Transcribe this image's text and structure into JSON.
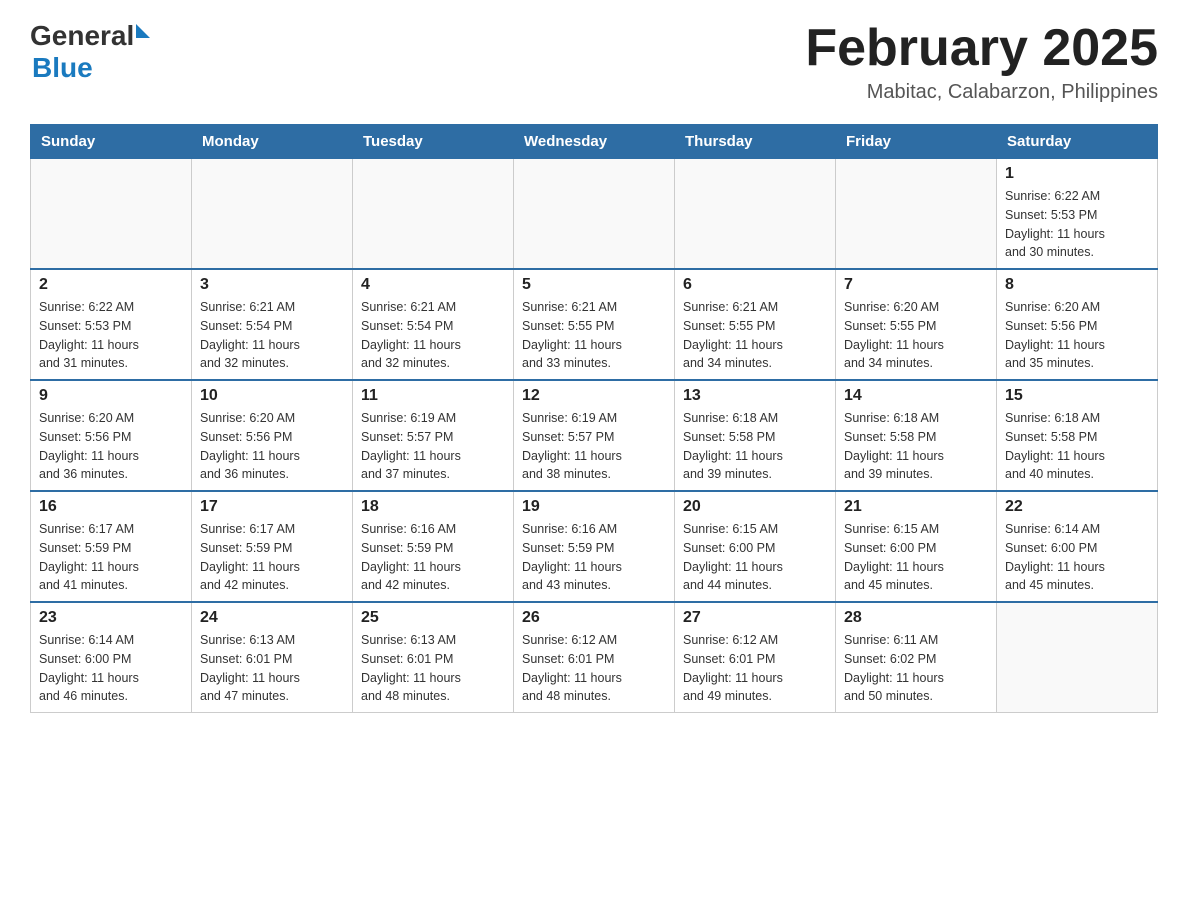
{
  "header": {
    "logo_general": "General",
    "logo_blue": "Blue",
    "title": "February 2025",
    "subtitle": "Mabitac, Calabarzon, Philippines"
  },
  "days_of_week": [
    "Sunday",
    "Monday",
    "Tuesday",
    "Wednesday",
    "Thursday",
    "Friday",
    "Saturday"
  ],
  "weeks": [
    [
      {
        "day": "",
        "info": ""
      },
      {
        "day": "",
        "info": ""
      },
      {
        "day": "",
        "info": ""
      },
      {
        "day": "",
        "info": ""
      },
      {
        "day": "",
        "info": ""
      },
      {
        "day": "",
        "info": ""
      },
      {
        "day": "1",
        "info": "Sunrise: 6:22 AM\nSunset: 5:53 PM\nDaylight: 11 hours\nand 30 minutes."
      }
    ],
    [
      {
        "day": "2",
        "info": "Sunrise: 6:22 AM\nSunset: 5:53 PM\nDaylight: 11 hours\nand 31 minutes."
      },
      {
        "day": "3",
        "info": "Sunrise: 6:21 AM\nSunset: 5:54 PM\nDaylight: 11 hours\nand 32 minutes."
      },
      {
        "day": "4",
        "info": "Sunrise: 6:21 AM\nSunset: 5:54 PM\nDaylight: 11 hours\nand 32 minutes."
      },
      {
        "day": "5",
        "info": "Sunrise: 6:21 AM\nSunset: 5:55 PM\nDaylight: 11 hours\nand 33 minutes."
      },
      {
        "day": "6",
        "info": "Sunrise: 6:21 AM\nSunset: 5:55 PM\nDaylight: 11 hours\nand 34 minutes."
      },
      {
        "day": "7",
        "info": "Sunrise: 6:20 AM\nSunset: 5:55 PM\nDaylight: 11 hours\nand 34 minutes."
      },
      {
        "day": "8",
        "info": "Sunrise: 6:20 AM\nSunset: 5:56 PM\nDaylight: 11 hours\nand 35 minutes."
      }
    ],
    [
      {
        "day": "9",
        "info": "Sunrise: 6:20 AM\nSunset: 5:56 PM\nDaylight: 11 hours\nand 36 minutes."
      },
      {
        "day": "10",
        "info": "Sunrise: 6:20 AM\nSunset: 5:56 PM\nDaylight: 11 hours\nand 36 minutes."
      },
      {
        "day": "11",
        "info": "Sunrise: 6:19 AM\nSunset: 5:57 PM\nDaylight: 11 hours\nand 37 minutes."
      },
      {
        "day": "12",
        "info": "Sunrise: 6:19 AM\nSunset: 5:57 PM\nDaylight: 11 hours\nand 38 minutes."
      },
      {
        "day": "13",
        "info": "Sunrise: 6:18 AM\nSunset: 5:58 PM\nDaylight: 11 hours\nand 39 minutes."
      },
      {
        "day": "14",
        "info": "Sunrise: 6:18 AM\nSunset: 5:58 PM\nDaylight: 11 hours\nand 39 minutes."
      },
      {
        "day": "15",
        "info": "Sunrise: 6:18 AM\nSunset: 5:58 PM\nDaylight: 11 hours\nand 40 minutes."
      }
    ],
    [
      {
        "day": "16",
        "info": "Sunrise: 6:17 AM\nSunset: 5:59 PM\nDaylight: 11 hours\nand 41 minutes."
      },
      {
        "day": "17",
        "info": "Sunrise: 6:17 AM\nSunset: 5:59 PM\nDaylight: 11 hours\nand 42 minutes."
      },
      {
        "day": "18",
        "info": "Sunrise: 6:16 AM\nSunset: 5:59 PM\nDaylight: 11 hours\nand 42 minutes."
      },
      {
        "day": "19",
        "info": "Sunrise: 6:16 AM\nSunset: 5:59 PM\nDaylight: 11 hours\nand 43 minutes."
      },
      {
        "day": "20",
        "info": "Sunrise: 6:15 AM\nSunset: 6:00 PM\nDaylight: 11 hours\nand 44 minutes."
      },
      {
        "day": "21",
        "info": "Sunrise: 6:15 AM\nSunset: 6:00 PM\nDaylight: 11 hours\nand 45 minutes."
      },
      {
        "day": "22",
        "info": "Sunrise: 6:14 AM\nSunset: 6:00 PM\nDaylight: 11 hours\nand 45 minutes."
      }
    ],
    [
      {
        "day": "23",
        "info": "Sunrise: 6:14 AM\nSunset: 6:00 PM\nDaylight: 11 hours\nand 46 minutes."
      },
      {
        "day": "24",
        "info": "Sunrise: 6:13 AM\nSunset: 6:01 PM\nDaylight: 11 hours\nand 47 minutes."
      },
      {
        "day": "25",
        "info": "Sunrise: 6:13 AM\nSunset: 6:01 PM\nDaylight: 11 hours\nand 48 minutes."
      },
      {
        "day": "26",
        "info": "Sunrise: 6:12 AM\nSunset: 6:01 PM\nDaylight: 11 hours\nand 48 minutes."
      },
      {
        "day": "27",
        "info": "Sunrise: 6:12 AM\nSunset: 6:01 PM\nDaylight: 11 hours\nand 49 minutes."
      },
      {
        "day": "28",
        "info": "Sunrise: 6:11 AM\nSunset: 6:02 PM\nDaylight: 11 hours\nand 50 minutes."
      },
      {
        "day": "",
        "info": ""
      }
    ]
  ]
}
